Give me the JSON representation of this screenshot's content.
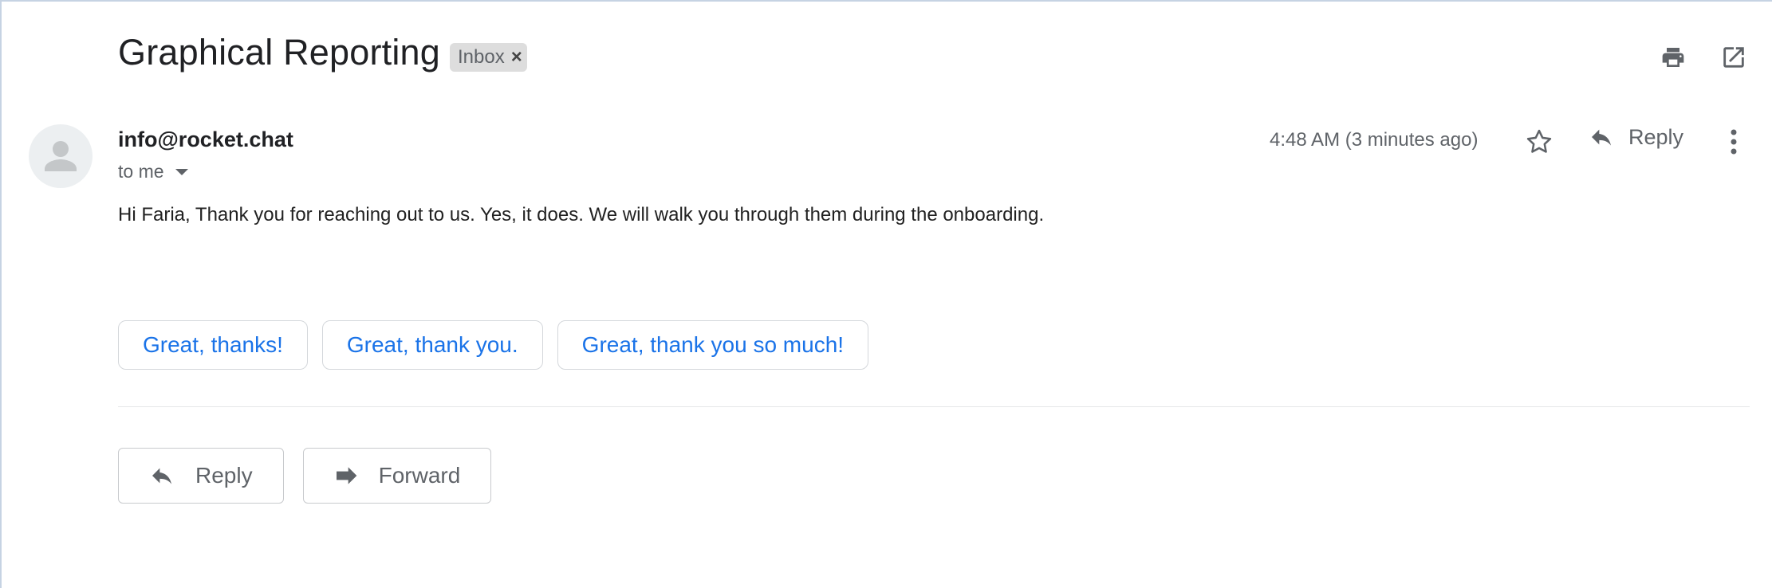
{
  "header": {
    "subject": "Graphical Reporting",
    "label": "Inbox",
    "label_remove": "×",
    "print_icon": "print-icon",
    "open_new_window_icon": "open-in-new-icon"
  },
  "message": {
    "sender": "info@rocket.chat",
    "recipient": "to me",
    "timestamp": "4:48 AM (3 minutes ago)",
    "reply_label": "Reply",
    "body": "Hi Faria, Thank you for reaching out to us. Yes, it does. We will walk you through them during the onboarding."
  },
  "smart_replies": [
    "Great, thanks!",
    "Great, thank you.",
    "Great, thank you so much!"
  ],
  "actions": {
    "reply": "Reply",
    "forward": "Forward"
  },
  "colors": {
    "accent": "#1a73e8",
    "icon": "#5f6368",
    "chip_bg": "#dddddd"
  }
}
